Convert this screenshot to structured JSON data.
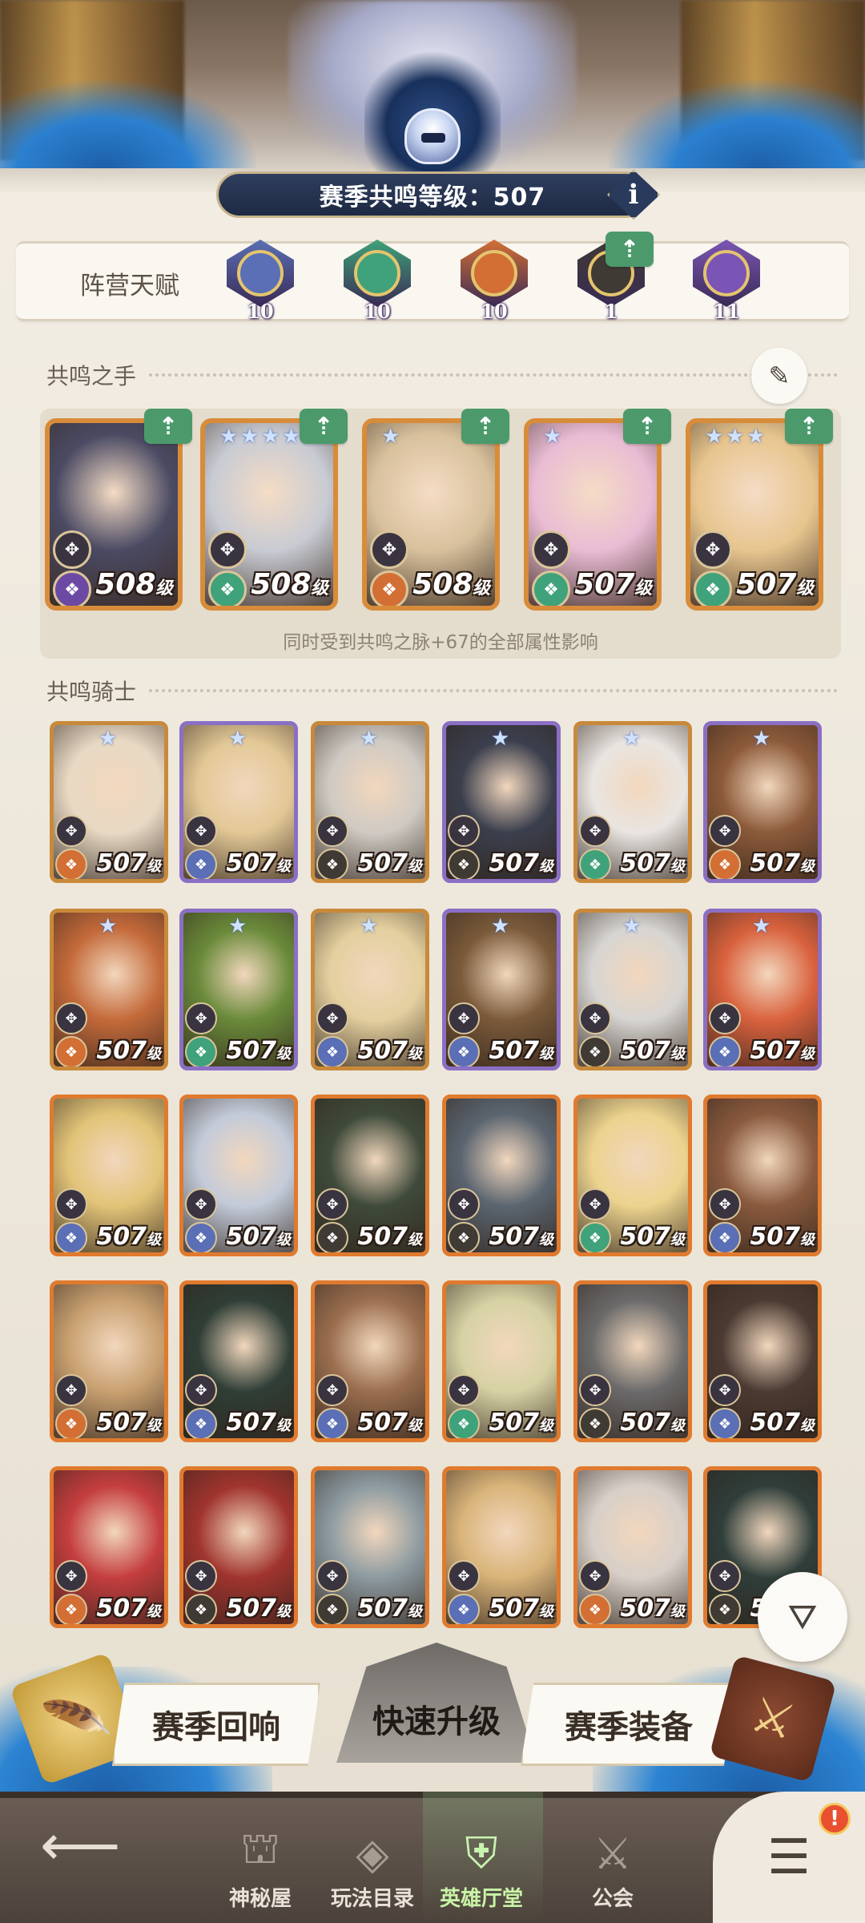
{
  "header": {
    "resonance_level_label": "赛季共鸣等级：507",
    "info_icon_glyph": "i"
  },
  "faction_talent": {
    "label": "阵营天赋",
    "items": [
      {
        "icon": "lightbearer-compass-icon",
        "level": "10",
        "upgrade": false,
        "color": "#5a6fb5"
      },
      {
        "icon": "wilder-leaf-icon",
        "level": "10",
        "upgrade": false,
        "color": "#3fa27a"
      },
      {
        "icon": "mauler-flame-icon",
        "level": "10",
        "upgrade": false,
        "color": "#d36f34"
      },
      {
        "icon": "graveborn-eye-icon",
        "level": "1",
        "upgrade": true,
        "color": "#3f3a33"
      },
      {
        "icon": "celestial-hypogean-icon",
        "level": "11",
        "upgrade": false,
        "color": "#7b55b5"
      }
    ]
  },
  "hand_section": {
    "title": "共鸣之手",
    "note": "同时受到共鸣之脉+67的全部属性影响",
    "unit": "级",
    "cards": [
      {
        "level": "508",
        "stars": 0,
        "upgrade": true,
        "bg": "#4a4a63",
        "faction": "#6c4aa3"
      },
      {
        "level": "508",
        "stars": 5,
        "upgrade": true,
        "bg": "#c8cbd3",
        "faction": "#3fa27a"
      },
      {
        "level": "508",
        "stars": 1,
        "upgrade": true,
        "bg": "#d8c19c",
        "faction": "#d36f34"
      },
      {
        "level": "507",
        "stars": 1,
        "upgrade": true,
        "bg": "#e9bcd4",
        "faction": "#3fa27a"
      },
      {
        "level": "507",
        "stars": 3,
        "upgrade": true,
        "bg": "#e7c58e",
        "faction": "#3fa27a"
      }
    ]
  },
  "knight_section": {
    "title": "共鸣骑士",
    "unit": "级",
    "rows": [
      [
        {
          "level": "507",
          "bg": "#e8d9c4",
          "faction": "#d36f34"
        },
        {
          "level": "507",
          "bg": "#e3c896",
          "faction": "#5a6fb5"
        },
        {
          "level": "507",
          "bg": "#cfcac3",
          "faction": "#3f3a33"
        },
        {
          "level": "507",
          "bg": "#3b3f4d",
          "faction": "#3f3a33"
        },
        {
          "level": "507",
          "bg": "#e9e5e1",
          "faction": "#3fa27a"
        },
        {
          "level": "507",
          "bg": "#8c5a3a",
          "faction": "#d36f34"
        }
      ],
      [
        {
          "level": "507",
          "bg": "#c46a3a",
          "faction": "#d36f34"
        },
        {
          "level": "507",
          "bg": "#6a8a3a",
          "faction": "#3fa27a"
        },
        {
          "level": "507",
          "bg": "#e3cf9e",
          "faction": "#5a6fb5"
        },
        {
          "level": "507",
          "bg": "#7a5a3a",
          "faction": "#5a6fb5"
        },
        {
          "level": "507",
          "bg": "#d7d5d2",
          "faction": "#3f3a33"
        },
        {
          "level": "507",
          "bg": "#d9623e",
          "faction": "#5a6fb5"
        }
      ],
      [
        {
          "level": "507",
          "bg": "#e2c478",
          "faction": "#5a6fb5"
        },
        {
          "level": "507",
          "bg": "#c3cbd9",
          "faction": "#5a6fb5"
        },
        {
          "level": "507",
          "bg": "#3f4a3a",
          "faction": "#3f3a33"
        },
        {
          "level": "507",
          "bg": "#5b6570",
          "faction": "#3f3a33"
        },
        {
          "level": "507",
          "bg": "#ecd38e",
          "faction": "#3fa27a"
        },
        {
          "level": "507",
          "bg": "#8a5a3e",
          "faction": "#5a6fb5"
        }
      ],
      [
        {
          "level": "507",
          "bg": "#c8a070",
          "faction": "#d36f34"
        },
        {
          "level": "507",
          "bg": "#2f3e36",
          "faction": "#5a6fb5"
        },
        {
          "level": "507",
          "bg": "#9a6e4e",
          "faction": "#5a6fb5"
        },
        {
          "level": "507",
          "bg": "#d6d2a4",
          "faction": "#3fa27a"
        },
        {
          "level": "507",
          "bg": "#6b6a6a",
          "faction": "#3f3a33"
        },
        {
          "level": "507",
          "bg": "#4a3a32",
          "faction": "#5a6fb5"
        }
      ],
      [
        {
          "level": "507",
          "bg": "#c43e3e",
          "faction": "#d36f34"
        },
        {
          "level": "507",
          "bg": "#a0342e",
          "faction": "#3f3a33"
        },
        {
          "level": "507",
          "bg": "#8c9aa0",
          "faction": "#3f3a33"
        },
        {
          "level": "507",
          "bg": "#d9b47a",
          "faction": "#5a6fb5"
        },
        {
          "level": "507",
          "bg": "#d7cfc8",
          "faction": "#d36f34"
        },
        {
          "level": "507",
          "bg": "#2f3e3a",
          "faction": "#3f3a33"
        }
      ]
    ]
  },
  "actions": {
    "left": "赛季回响",
    "center": "快速升级",
    "right": "赛季装备"
  },
  "nav": {
    "items": [
      {
        "label": "神秘屋",
        "icon": "mystic-house-icon",
        "glyph": "⛫",
        "active": false
      },
      {
        "label": "玩法目录",
        "icon": "game-modes-icon",
        "glyph": "◈",
        "active": false
      },
      {
        "label": "英雄厅堂",
        "icon": "hero-hall-helmet-icon",
        "glyph": "⛨",
        "active": true
      },
      {
        "label": "公会",
        "icon": "guild-swords-icon",
        "glyph": "⚔",
        "active": false
      }
    ],
    "alert": "!"
  },
  "colors": {
    "accent": "#d88c3a",
    "upgrade_green": "#4c9a6c",
    "nav_bg": "#5b4f47"
  }
}
